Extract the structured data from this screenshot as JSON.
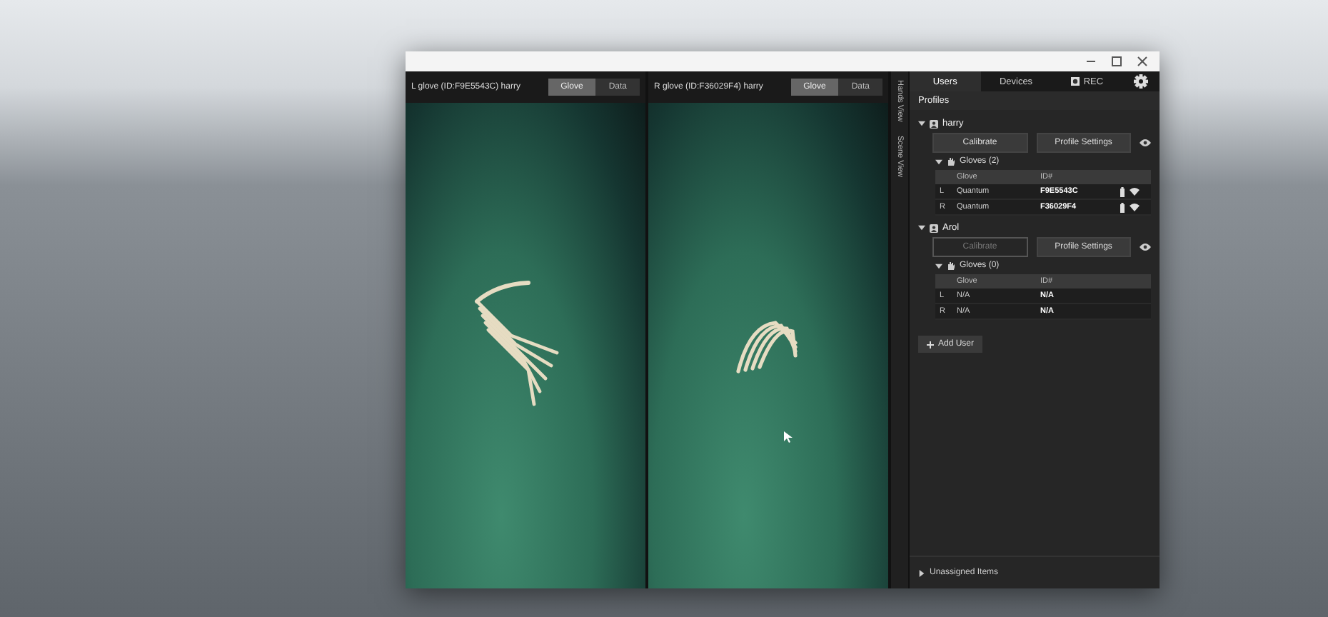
{
  "viewports": [
    {
      "title": "L glove (ID:F9E5543C) harry",
      "tabs": [
        {
          "label": "Glove",
          "selected": true
        },
        {
          "label": "Data",
          "selected": false
        }
      ]
    },
    {
      "title": "R glove (ID:F36029F4) harry",
      "tabs": [
        {
          "label": "Glove",
          "selected": true
        },
        {
          "label": "Data",
          "selected": false
        }
      ]
    }
  ],
  "side_tabs": [
    {
      "label": "Hands View"
    },
    {
      "label": "Scene View"
    }
  ],
  "panel_tabs": [
    {
      "label": "Users",
      "kind": "text",
      "selected": true
    },
    {
      "label": "Devices",
      "kind": "text",
      "selected": false
    },
    {
      "label": "REC",
      "kind": "record",
      "selected": false
    }
  ],
  "section_title": "Profiles",
  "profiles": [
    {
      "name": "harry",
      "expanded": true,
      "buttons": [
        {
          "label": "Calibrate",
          "disabled": false
        },
        {
          "label": "Profile Settings",
          "disabled": false
        }
      ],
      "gloves_label": "Gloves (2)",
      "gloves_expanded": true,
      "columns": [
        "Glove",
        "ID#"
      ],
      "rows": [
        {
          "side": "L",
          "glove": "Quantum",
          "id": "F9E5543C",
          "connected": true
        },
        {
          "side": "R",
          "glove": "Quantum",
          "id": "F36029F4",
          "connected": true
        }
      ]
    },
    {
      "name": "Arol",
      "expanded": true,
      "buttons": [
        {
          "label": "Calibrate",
          "disabled": true
        },
        {
          "label": "Profile Settings",
          "disabled": false
        }
      ],
      "gloves_label": "Gloves (0)",
      "gloves_expanded": true,
      "columns": [
        "Glove",
        "ID#"
      ],
      "rows": [
        {
          "side": "L",
          "glove": "N/A",
          "id": "N/A",
          "connected": false
        },
        {
          "side": "R",
          "glove": "N/A",
          "id": "N/A",
          "connected": false
        }
      ]
    }
  ],
  "add_user": "Add User",
  "unassigned": {
    "label": "Unassigned Items",
    "expanded": false
  }
}
